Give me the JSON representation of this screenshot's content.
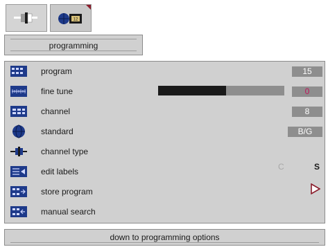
{
  "colors": {
    "accent": "#8b1d2c",
    "panel": "#d0d0d0",
    "value_box": "#8e8e8e",
    "icon_blue": "#1e3a8a"
  },
  "tabs": [
    {
      "icon": "connector-icon"
    },
    {
      "icon": "globe-tv-icon"
    }
  ],
  "header": {
    "title": "programming"
  },
  "menu": {
    "items": [
      {
        "label": "program",
        "icon": "program-icon"
      },
      {
        "label": "fine tune",
        "icon": "fine-tune-icon"
      },
      {
        "label": "channel",
        "icon": "channel-icon"
      },
      {
        "label": "standard",
        "icon": "globe-icon"
      },
      {
        "label": "channel type",
        "icon": "channel-type-icon"
      },
      {
        "label": "edit labels",
        "icon": "edit-labels-icon"
      },
      {
        "label": "store program",
        "icon": "store-program-icon"
      },
      {
        "label": "manual search",
        "icon": "manual-search-icon"
      }
    ]
  },
  "values": {
    "program": "15",
    "fine_tune_level": 0.54,
    "fine_tune": "0",
    "channel": "8",
    "standard": "B/G",
    "channel_type_c": "C",
    "channel_type_s": "S"
  },
  "footer": {
    "hint": "down to programming options"
  }
}
